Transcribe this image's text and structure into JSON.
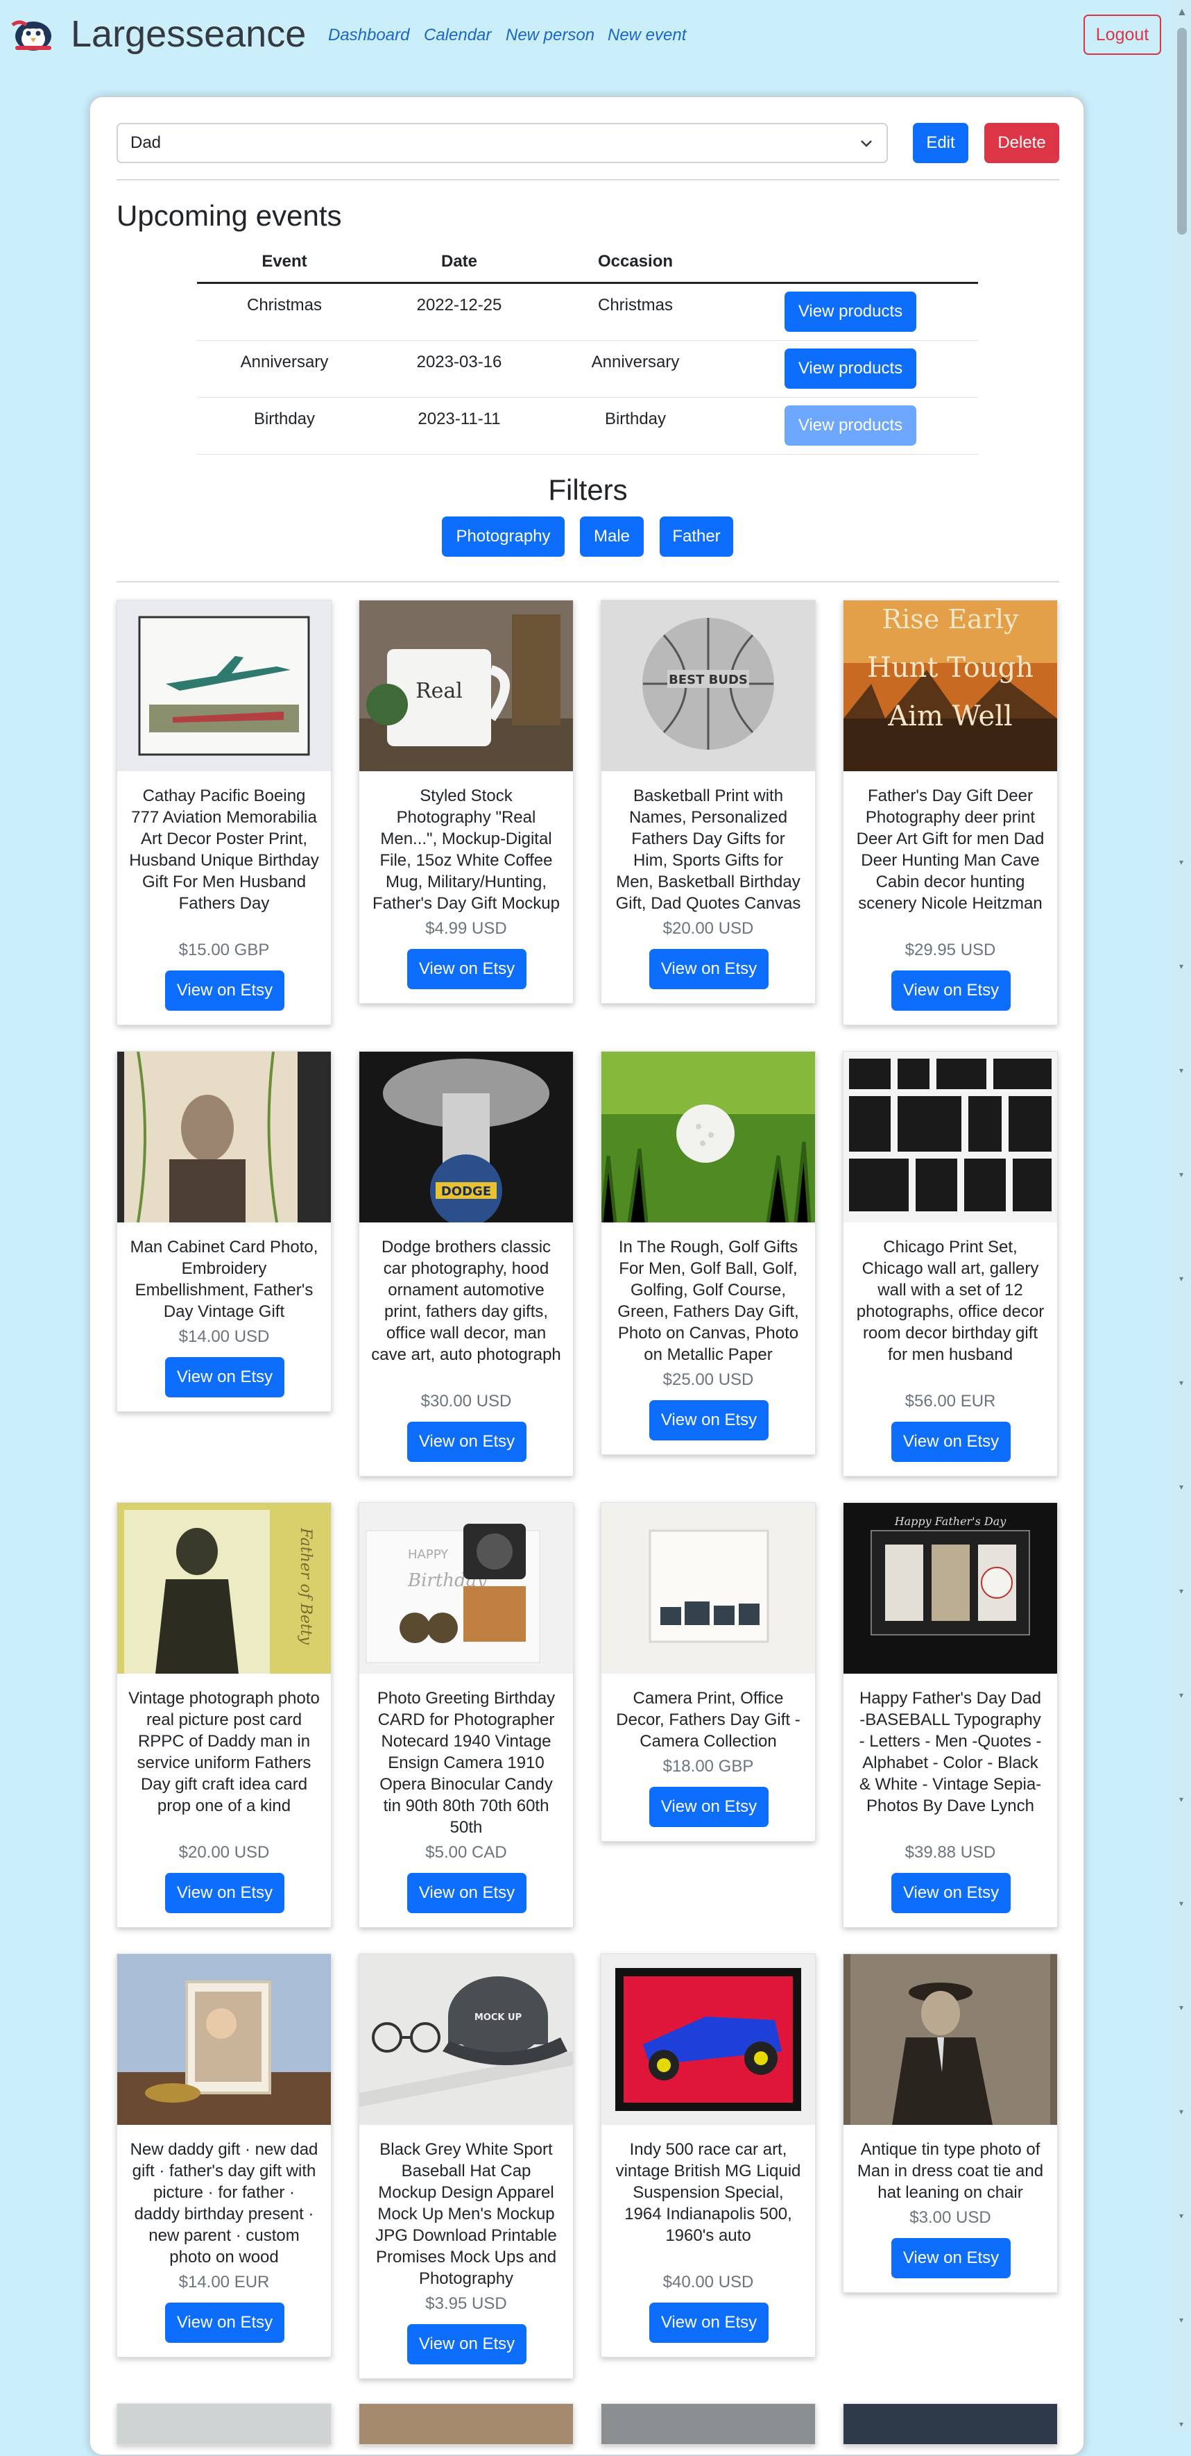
{
  "nav": {
    "brand": "Largesseance",
    "links": [
      "Dashboard",
      "Calendar",
      "New person",
      "New event"
    ],
    "logout": "Logout"
  },
  "person": {
    "selected": "Dad",
    "edit": "Edit",
    "delete": "Delete"
  },
  "events": {
    "heading": "Upcoming events",
    "headers": [
      "Event",
      "Date",
      "Occasion"
    ],
    "rows": [
      {
        "event": "Christmas",
        "date": "2022-12-25",
        "occasion": "Christmas",
        "action": "View products"
      },
      {
        "event": "Anniversary",
        "date": "2023-03-16",
        "occasion": "Anniversary",
        "action": "View products"
      },
      {
        "event": "Birthday",
        "date": "2023-11-11",
        "occasion": "Birthday",
        "action": "View products"
      }
    ]
  },
  "filters": {
    "heading": "Filters",
    "tags": [
      "Photography",
      "Male",
      "Father"
    ]
  },
  "products": [
    {
      "title": "Cathay Pacific Boeing 777 Aviation Memorabilia Art Decor Poster Print, Husband Unique Birthday Gift For Men Husband Fathers Day",
      "price": "$15.00 GBP",
      "button": "View on Etsy",
      "image": "airplane-poster-image"
    },
    {
      "title": "Styled Stock Photography \"Real Men...\", Mockup-Digital File, 15oz White Coffee Mug, Military/Hunting, Father's Day Gift Mockup",
      "price": "$4.99 USD",
      "button": "View on Etsy",
      "image": "coffee-mug-image"
    },
    {
      "title": "Basketball Print with Names, Personalized Fathers Day Gifts for Him, Sports Gifts for Men, Basketball Birthday Gift, Dad Quotes Canvas",
      "price": "$20.00 USD",
      "button": "View on Etsy",
      "image": "basketball-image"
    },
    {
      "title": "Father's Day Gift Deer Photography deer print Deer Art Gift for men Dad Deer Hunting Man Cave Cabin decor hunting scenery Nicole Heitzman",
      "price": "$29.95 USD",
      "button": "View on Etsy",
      "image": "deer-sunset-image"
    },
    {
      "title": "Man Cabinet Card Photo, Embroidery Embellishment, Father's Day Vintage Gift",
      "price": "$14.00 USD",
      "button": "View on Etsy",
      "image": "cabinet-card-image"
    },
    {
      "title": "Dodge brothers classic car photography, hood ornament automotive print, fathers day gifts, office wall decor, man cave art, auto photograph",
      "price": "$30.00 USD",
      "button": "View on Etsy",
      "image": "hood-ornament-image"
    },
    {
      "title": "In The Rough, Golf Gifts For Men, Golf Ball, Golf, Golfing, Golf Course, Green, Fathers Day Gift, Photo on Canvas, Photo on Metallic Paper",
      "price": "$25.00 USD",
      "button": "View on Etsy",
      "image": "golf-ball-image"
    },
    {
      "title": "Chicago Print Set, Chicago wall art, gallery wall with a set of 12 photographs, office decor room decor birthday gift for men husband",
      "price": "$56.00 EUR",
      "button": "View on Etsy",
      "image": "gallery-wall-image"
    },
    {
      "title": "Vintage photograph photo real picture post card RPPC of Daddy man in service uniform Fathers Day gift craft idea card prop one of a kind",
      "price": "$20.00 USD",
      "button": "View on Etsy",
      "image": "vintage-postcard-image"
    },
    {
      "title": "Photo Greeting Birthday CARD for Photographer Notecard 1940 Vintage Ensign Camera 1910 Opera Binocular Candy tin 90th 80th 70th 60th 50th",
      "price": "$5.00 CAD",
      "button": "View on Etsy",
      "image": "birthday-card-image"
    },
    {
      "title": "Camera Print, Office Decor, Fathers Day Gift - Camera Collection",
      "price": "$18.00 GBP",
      "button": "View on Etsy",
      "image": "camera-print-image"
    },
    {
      "title": "Happy Father's Day Dad -BASEBALL Typography - Letters - Men -Quotes - Alphabet - Color - Black & White - Vintage Sepia- Photos By Dave Lynch",
      "price": "$39.88 USD",
      "button": "View on Etsy",
      "image": "baseball-letters-image"
    },
    {
      "title": "New daddy gift · new dad gift · father's day gift with picture · for father · daddy birthday present · new parent · custom photo on wood",
      "price": "$14.00 EUR",
      "button": "View on Etsy",
      "image": "photo-on-wood-image"
    },
    {
      "title": "Black Grey White Sport Baseball Hat Cap Mockup Design Apparel Mock Up Men's Mockup JPG Download Printable Promises Mock Ups and Photography",
      "price": "$3.95 USD",
      "button": "View on Etsy",
      "image": "hat-mockup-image"
    },
    {
      "title": "Indy 500 race car art, vintage British MG Liquid Suspension Special, 1964 Indianapolis 500, 1960's auto",
      "price": "$40.00 USD",
      "button": "View on Etsy",
      "image": "race-car-image"
    },
    {
      "title": "Antique tin type photo of Man in dress coat tie and hat leaning on chair",
      "price": "$3.00 USD",
      "button": "View on Etsy",
      "image": "tintype-photo-image"
    }
  ],
  "colors": {
    "page_background": "#cbeefb",
    "primary": "#0d6efd",
    "danger": "#dc3545",
    "link": "#1a66cc"
  }
}
